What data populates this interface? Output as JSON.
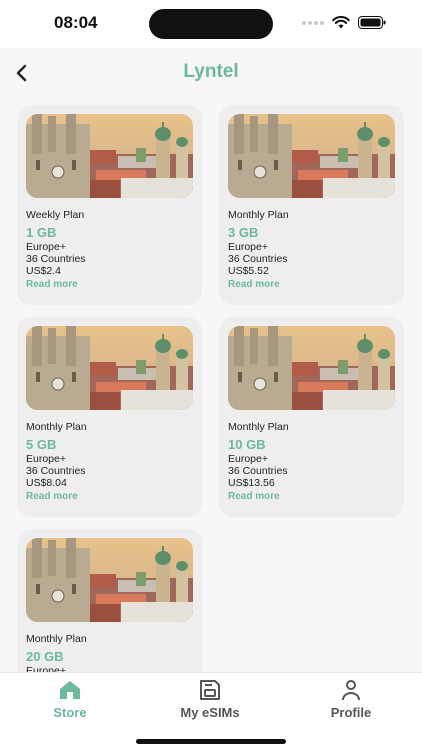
{
  "status": {
    "time": "08:04"
  },
  "header": {
    "title": "Lyntel"
  },
  "plans": [
    {
      "type": "Weekly Plan",
      "data": "1 GB",
      "region": "Europe+",
      "countries": "36 Countries",
      "price": "US$2.4",
      "link": "Read more"
    },
    {
      "type": "Monthly Plan",
      "data": "3 GB",
      "region": "Europe+",
      "countries": "36 Countries",
      "price": "US$5.52",
      "link": "Read more"
    },
    {
      "type": "Monthly Plan",
      "data": "5 GB",
      "region": "Europe+",
      "countries": "36 Countries",
      "price": "US$8.04",
      "link": "Read more"
    },
    {
      "type": "Monthly Plan",
      "data": "10 GB",
      "region": "Europe+",
      "countries": "36 Countries",
      "price": "US$13.56",
      "link": "Read more"
    },
    {
      "type": "Monthly Plan",
      "data": "20 GB",
      "region": "Europe+",
      "countries": "",
      "price": "",
      "link": ""
    }
  ],
  "tabs": [
    {
      "label": "Store",
      "icon": "store-icon",
      "active": true
    },
    {
      "label": "My eSIMs",
      "icon": "sim-card-icon",
      "active": false
    },
    {
      "label": "Profile",
      "icon": "profile-icon",
      "active": false
    }
  ],
  "colors": {
    "accent": "#6db99b",
    "inactive": "#555555",
    "card": "#eeeeee"
  }
}
